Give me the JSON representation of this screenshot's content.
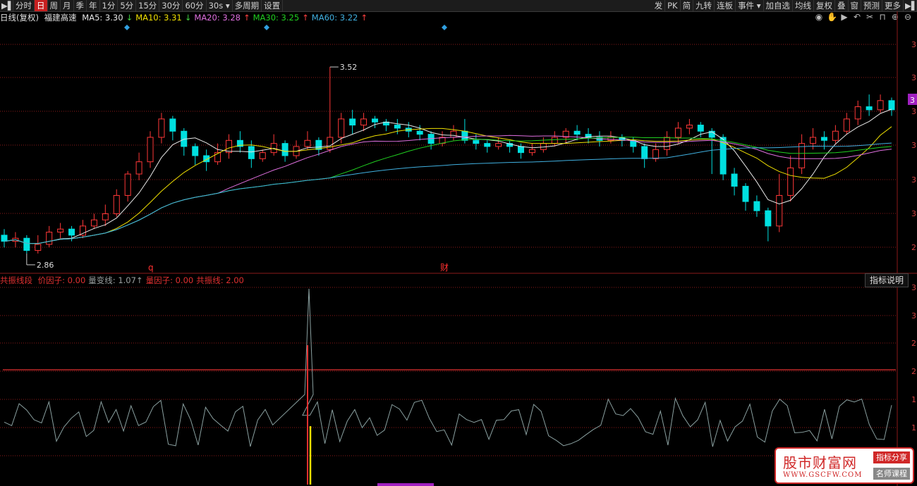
{
  "toolbar": {
    "left": [
      "分时",
      "日",
      "周",
      "月",
      "季",
      "年",
      "1分",
      "5分",
      "15分",
      "30分",
      "60分",
      "30s",
      "多周期",
      "设置"
    ],
    "active_index": 1,
    "right": [
      "发",
      "PK",
      "简",
      "九转",
      "连板",
      "事件",
      "加自选",
      "均线",
      "复权",
      "叠",
      "窗",
      "预测",
      "更多"
    ]
  },
  "chart_header": {
    "period": "日线(复权)",
    "stock": "福建高速",
    "ma": [
      {
        "label": "MA5: 3.30",
        "arrow": "↓",
        "color": "#e8e8e8"
      },
      {
        "label": "MA10: 3.31",
        "arrow": "↓",
        "color": "#f0e000"
      },
      {
        "label": "MA20: 3.28",
        "arrow": "↑",
        "color": "#e070e0"
      },
      {
        "label": "MA30: 3.25",
        "arrow": "↑",
        "color": "#20d020"
      },
      {
        "label": "MA60: 3.22",
        "arrow": "↑",
        "color": "#40b0e0"
      }
    ]
  },
  "price_labels": {
    "high": "3.52",
    "low": "2.86",
    "marker_q": "q",
    "marker_cai": "财",
    "right_badge": "3"
  },
  "right_axis_main": [
    "3",
    "3",
    "3",
    "3",
    "3",
    "3",
    "2"
  ],
  "right_axis_sub": [
    "3",
    "3",
    "2",
    "2",
    "1",
    "1"
  ],
  "sub_header": {
    "name": "共振线段",
    "items": [
      {
        "label": "价因子: 0.00",
        "color": "#e03030"
      },
      {
        "label": "量变线: 1.07↑",
        "color": "#9aa0a0"
      },
      {
        "label": "量因子: 0.00",
        "color": "#e03030"
      },
      {
        "label": "共振线: 2.00",
        "color": "#e03030"
      }
    ],
    "button": "指标说明"
  },
  "watermark": {
    "title": "股市财富网",
    "url": "WWW.GSCFW.COM",
    "tag1": "指标分享",
    "tag2": "名师课程"
  },
  "colors": {
    "up": "#ff3838",
    "down": "#00e0e0",
    "ma5": "#e8e8e8",
    "ma10": "#f0e000",
    "ma20": "#e070e0",
    "ma30": "#20d020",
    "ma60": "#40b0e0",
    "grid": "#8b1a1a"
  },
  "chart_data": {
    "type": "candlestick",
    "ylim": [
      2.8,
      3.56
    ],
    "candles": [
      [
        2.92,
        2.9,
        2.94,
        2.88
      ],
      [
        2.9,
        2.91,
        2.93,
        2.88
      ],
      [
        2.91,
        2.87,
        2.92,
        2.86
      ],
      [
        2.87,
        2.89,
        2.92,
        2.86
      ],
      [
        2.89,
        2.93,
        2.95,
        2.88
      ],
      [
        2.93,
        2.94,
        2.96,
        2.91
      ],
      [
        2.94,
        2.92,
        2.95,
        2.9
      ],
      [
        2.92,
        2.95,
        2.97,
        2.91
      ],
      [
        2.95,
        2.97,
        2.99,
        2.94
      ],
      [
        2.97,
        2.99,
        3.02,
        2.95
      ],
      [
        2.99,
        3.05,
        3.07,
        2.98
      ],
      [
        3.05,
        3.12,
        3.13,
        3.03
      ],
      [
        3.12,
        3.16,
        3.19,
        3.1
      ],
      [
        3.16,
        3.24,
        3.26,
        3.14
      ],
      [
        3.24,
        3.3,
        3.32,
        3.22
      ],
      [
        3.3,
        3.26,
        3.31,
        3.23
      ],
      [
        3.26,
        3.21,
        3.27,
        3.18
      ],
      [
        3.21,
        3.18,
        3.22,
        3.15
      ],
      [
        3.18,
        3.16,
        3.2,
        3.13
      ],
      [
        3.16,
        3.19,
        3.22,
        3.15
      ],
      [
        3.19,
        3.23,
        3.25,
        3.17
      ],
      [
        3.23,
        3.21,
        3.26,
        3.19
      ],
      [
        3.21,
        3.17,
        3.23,
        3.14
      ],
      [
        3.17,
        3.19,
        3.2,
        3.16
      ],
      [
        3.19,
        3.22,
        3.25,
        3.18
      ],
      [
        3.22,
        3.18,
        3.23,
        3.16
      ],
      [
        3.18,
        3.21,
        3.23,
        3.17
      ],
      [
        3.21,
        3.23,
        3.26,
        3.2
      ],
      [
        3.23,
        3.2,
        3.24,
        3.18
      ],
      [
        3.2,
        3.24,
        3.47,
        3.19
      ],
      [
        3.24,
        3.3,
        3.32,
        3.22
      ],
      [
        3.3,
        3.28,
        3.33,
        3.25
      ],
      [
        3.28,
        3.3,
        3.32,
        3.26
      ],
      [
        3.3,
        3.29,
        3.31,
        3.27
      ],
      [
        3.29,
        3.28,
        3.3,
        3.26
      ],
      [
        3.28,
        3.27,
        3.3,
        3.25
      ],
      [
        3.27,
        3.26,
        3.29,
        3.24
      ],
      [
        3.26,
        3.25,
        3.28,
        3.23
      ],
      [
        3.25,
        3.22,
        3.26,
        3.2
      ],
      [
        3.22,
        3.24,
        3.26,
        3.21
      ],
      [
        3.24,
        3.26,
        3.28,
        3.23
      ],
      [
        3.26,
        3.23,
        3.3,
        3.22
      ],
      [
        3.23,
        3.22,
        3.25,
        3.2
      ],
      [
        3.22,
        3.21,
        3.23,
        3.19
      ],
      [
        3.21,
        3.22,
        3.24,
        3.2
      ],
      [
        3.22,
        3.21,
        3.23,
        3.19
      ],
      [
        3.21,
        3.19,
        3.22,
        3.17
      ],
      [
        3.19,
        3.2,
        3.22,
        3.18
      ],
      [
        3.2,
        3.22,
        3.24,
        3.19
      ],
      [
        3.22,
        3.24,
        3.26,
        3.21
      ],
      [
        3.24,
        3.26,
        3.27,
        3.22
      ],
      [
        3.26,
        3.25,
        3.28,
        3.23
      ],
      [
        3.25,
        3.24,
        3.27,
        3.22
      ],
      [
        3.24,
        3.23,
        3.26,
        3.21
      ],
      [
        3.23,
        3.24,
        3.26,
        3.22
      ],
      [
        3.24,
        3.23,
        3.25,
        3.21
      ],
      [
        3.23,
        3.21,
        3.24,
        3.19
      ],
      [
        3.21,
        3.17,
        3.22,
        3.14
      ],
      [
        3.17,
        3.2,
        3.22,
        3.16
      ],
      [
        3.2,
        3.24,
        3.26,
        3.18
      ],
      [
        3.24,
        3.27,
        3.29,
        3.22
      ],
      [
        3.27,
        3.28,
        3.3,
        3.25
      ],
      [
        3.28,
        3.26,
        3.29,
        3.24
      ],
      [
        3.26,
        3.24,
        3.27,
        3.12
      ],
      [
        3.24,
        3.12,
        3.25,
        3.1
      ],
      [
        3.12,
        3.08,
        3.14,
        3.05
      ],
      [
        3.08,
        3.03,
        3.09,
        3.0
      ],
      [
        3.03,
        3.0,
        3.05,
        2.98
      ],
      [
        3.0,
        2.95,
        3.01,
        2.9
      ],
      [
        2.95,
        3.05,
        3.12,
        2.93
      ],
      [
        3.05,
        3.14,
        3.18,
        3.03
      ],
      [
        3.14,
        3.22,
        3.25,
        3.12
      ],
      [
        3.22,
        3.24,
        3.27,
        3.2
      ],
      [
        3.24,
        3.23,
        3.26,
        3.2
      ],
      [
        3.23,
        3.26,
        3.28,
        3.22
      ],
      [
        3.26,
        3.3,
        3.32,
        3.25
      ],
      [
        3.3,
        3.34,
        3.36,
        3.28
      ],
      [
        3.34,
        3.33,
        3.38,
        3.31
      ],
      [
        3.33,
        3.36,
        3.38,
        3.32
      ],
      [
        3.36,
        3.33,
        3.37,
        3.31
      ]
    ]
  }
}
